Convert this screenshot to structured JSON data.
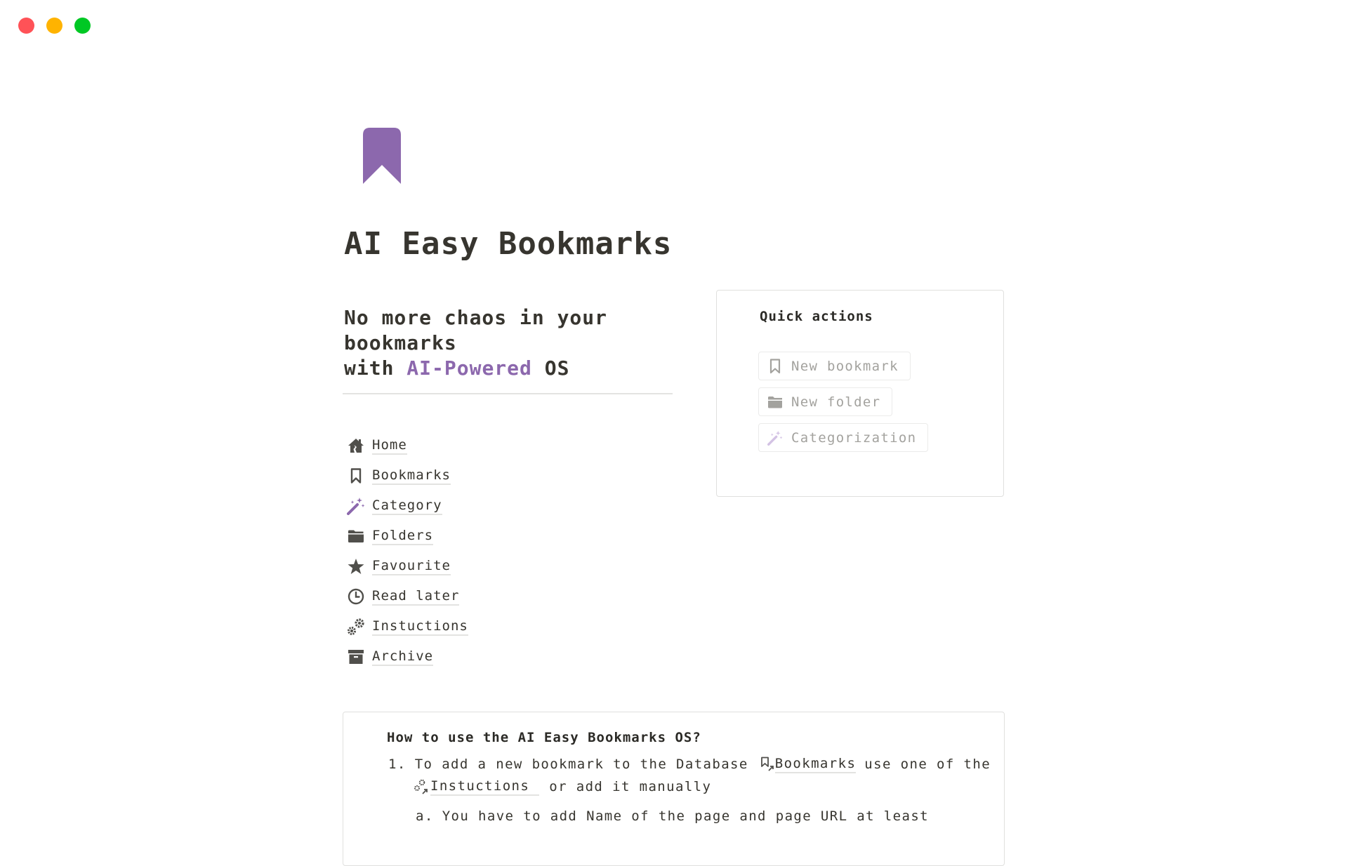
{
  "window": {
    "traffic_lights": [
      {
        "name": "close",
        "color": "#ff5257"
      },
      {
        "name": "minimize",
        "color": "#ffb300"
      },
      {
        "name": "maximize",
        "color": "#00c824"
      }
    ]
  },
  "page": {
    "icon": "bookmark-icon",
    "icon_color": "#8c68ad",
    "title": "AI Easy Bookmarks",
    "tagline": {
      "line1": "No more chaos in your",
      "line2": "bookmarks",
      "line3_prefix": "with ",
      "line3_accent": "AI-Powered",
      "line3_suffix": " OS",
      "accent_color": "#8c68ad"
    }
  },
  "nav": {
    "items": [
      {
        "label": "Home",
        "icon": "home-icon"
      },
      {
        "label": "Bookmarks",
        "icon": "bookmark-icon"
      },
      {
        "label": "Category",
        "icon": "magic-wand-icon"
      },
      {
        "label": "Folders",
        "icon": "folder-icon"
      },
      {
        "label": "Favourite",
        "icon": "star-icon"
      },
      {
        "label": "Read later",
        "icon": "clock-icon"
      },
      {
        "label": "Instuctions",
        "icon": "gears-icon"
      },
      {
        "label": "Archive",
        "icon": "archive-icon"
      }
    ]
  },
  "quick_actions": {
    "title": "Quick actions",
    "buttons": [
      {
        "label": "New bookmark",
        "icon": "bookmark-icon"
      },
      {
        "label": "New folder",
        "icon": "folder-icon"
      },
      {
        "label": "Categorization",
        "icon": "magic-wand-icon"
      }
    ]
  },
  "how_to": {
    "title": "How to use the AI Easy Bookmarks OS?",
    "step1_number": "1.",
    "step1_text_a": "To add a new bookmark to the Database",
    "step1_link1": "Bookmarks",
    "step1_text_b": "use one of the",
    "step1_link2": "Instuctions",
    "step1_text_c": "or add it manually",
    "step1a_letter": "a.",
    "step1a_text": "You have to add Name of the page and page URL at least"
  }
}
